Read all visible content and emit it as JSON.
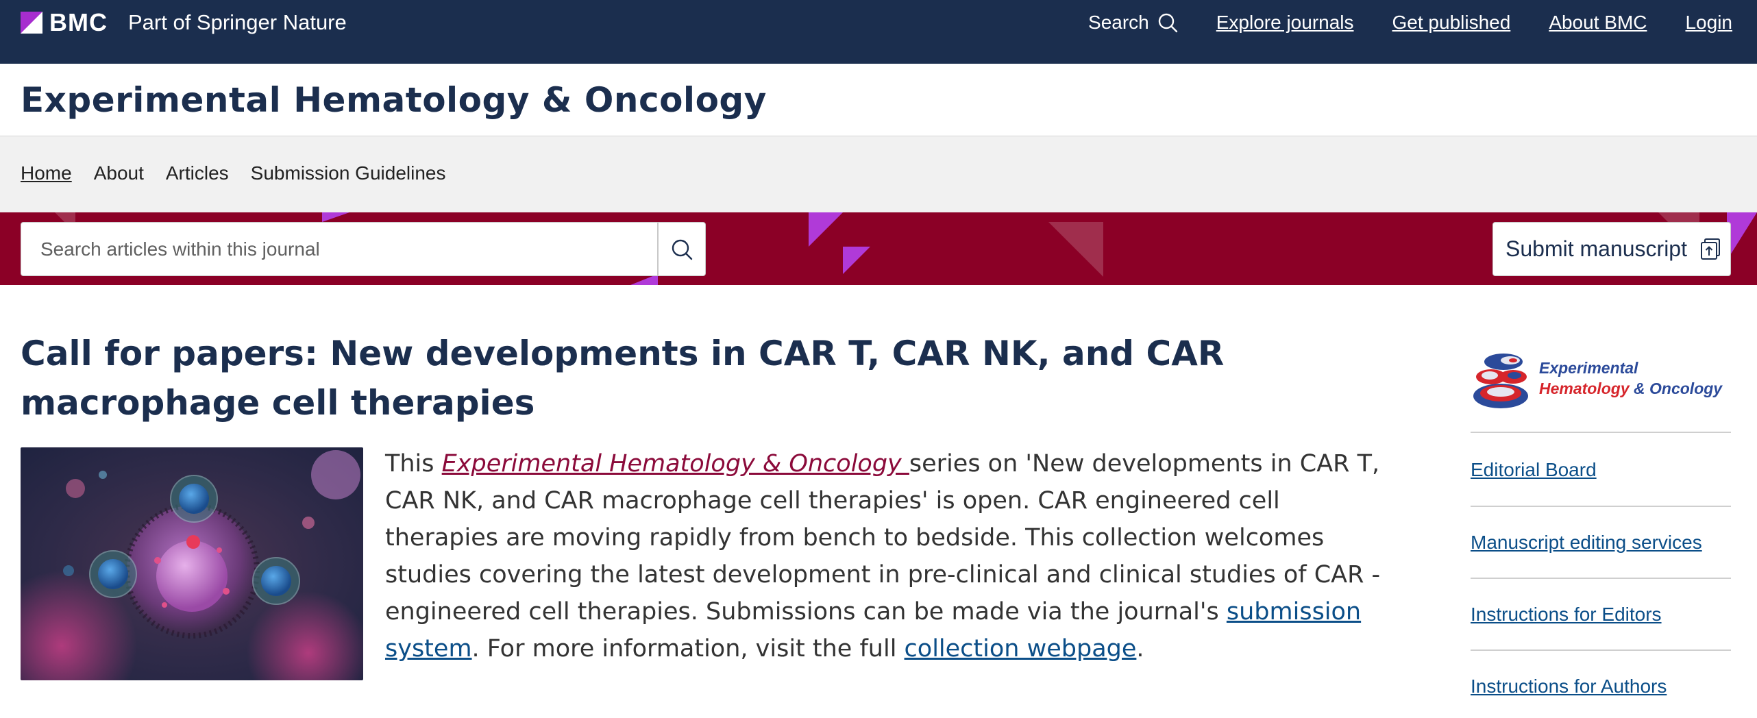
{
  "topbar": {
    "brand": "BMC",
    "tagline": "Part of Springer Nature",
    "search_label": "Search",
    "nav": [
      "Explore journals",
      "Get published",
      "About BMC",
      "Login"
    ]
  },
  "journal": {
    "title": "Experimental Hematology & Oncology"
  },
  "secondary_nav": {
    "items": [
      "Home",
      "About",
      "Articles",
      "Submission Guidelines"
    ],
    "active": "Home"
  },
  "banner": {
    "search_placeholder": "Search articles within this journal",
    "submit_label": "Submit manuscript"
  },
  "article": {
    "title": "Call for papers: New developments in CAR T, CAR NK, and CAR macrophage cell therapies",
    "body": {
      "pre": "This ",
      "journal_link": "Experimental Hematology & Oncology ",
      "mid1": " series on 'New developments in CAR T, CAR NK, and CAR macrophage cell therapies' is open. CAR engineered cell therapies are moving rapidly from bench to bedside. This collection welcomes studies covering the latest development in pre-clinical and clinical studies of CAR -engineered cell therapies. Submissions can be made via the journal's ",
      "submission_link": "submission system",
      "mid2": ". For more information, visit the full ",
      "collection_link": "collection webpage",
      "end": "."
    }
  },
  "sidebar": {
    "logo_line1": "Experimental",
    "logo_line2_red": "Hematology",
    "logo_line2_rest": " & Oncology",
    "links": [
      "Editorial Board",
      "Manuscript editing services",
      "Instructions for Editors",
      "Instructions for Authors"
    ]
  },
  "colors": {
    "topbar": "#1b2e4e",
    "banner": "#8b0026",
    "accent_purple": "#a72dcf",
    "link_blue": "#0b4e88",
    "journal_link": "#8b0a3a"
  }
}
